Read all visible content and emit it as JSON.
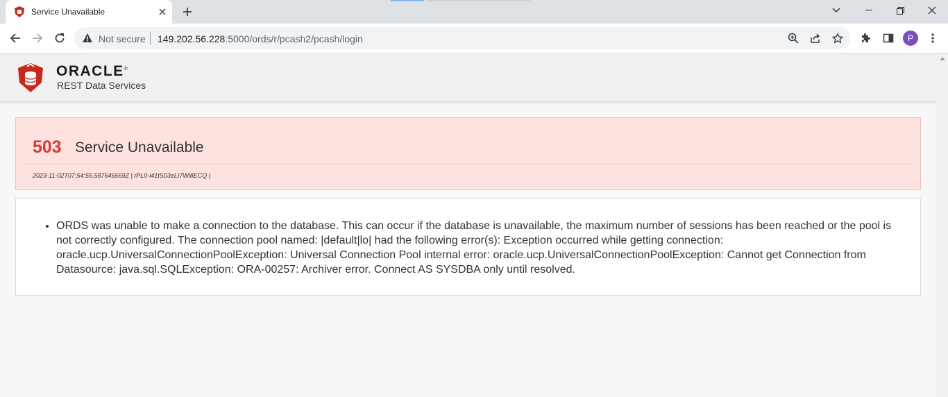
{
  "browser": {
    "tab_title": "Service Unavailable",
    "omnibox": {
      "security_label": "Not secure",
      "url_host": "149.202.56.228",
      "url_rest": ":5000/ords/r/pcash2/pcash/login"
    },
    "profile_initial": "P",
    "icons": [
      "shield-favicon-icon",
      "close-icon",
      "plus-icon",
      "chevron-down-icon",
      "minimize-icon",
      "restore-icon",
      "window-close-icon",
      "back-arrow-icon",
      "forward-arrow-icon",
      "reload-icon",
      "warning-icon",
      "zoom-icon",
      "share-icon",
      "star-icon",
      "puzzle-icon",
      "side-panel-icon",
      "kebab-menu-icon"
    ]
  },
  "header": {
    "brand": "ORACLE",
    "brand_mark": "®",
    "subtitle": "REST Data Services"
  },
  "error": {
    "code": "503",
    "title": "Service Unavailable",
    "meta": "2023-11-02T07:54:55.587646569Z | rPL0-l41tS03eLI7Wi8ECQ |"
  },
  "details": {
    "items": [
      "ORDS was unable to make a connection to the database. This can occur if the database is unavailable, the maximum number of sessions has been reached or the pool is not correctly configured. The connection pool named: |default|lo| had the following error(s): Exception occurred while getting connection: oracle.ucp.UniversalConnectionPoolException: Universal Connection Pool internal error: oracle.ucp.UniversalConnectionPoolException: Cannot get Connection from Datasource: java.sql.SQLException: ORA-00257: Archiver error. Connect AS SYSDBA only until resolved."
    ]
  },
  "colors": {
    "error_code": "#d63b36",
    "error_background": "#fde2e0",
    "ords_logo": "#c7281c",
    "avatar": "#7c4dbf"
  }
}
